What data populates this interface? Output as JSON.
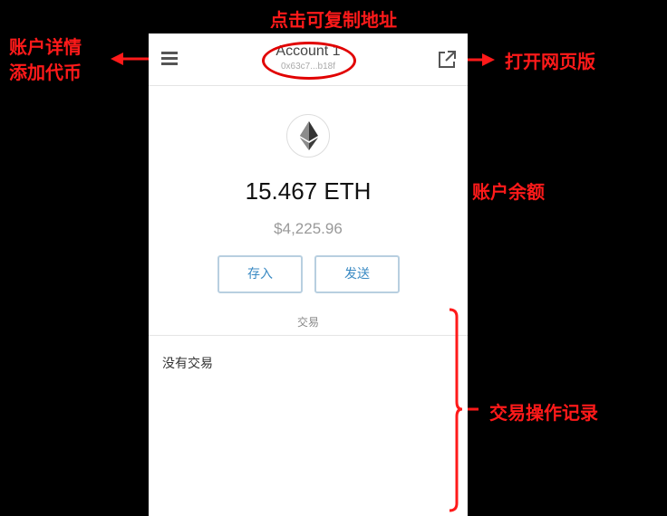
{
  "annotations": {
    "top": "点击可复制地址",
    "left_line1": "账户详情",
    "left_line2": "添加代币",
    "right_open": "打开网页版",
    "right_balance": "账户余额",
    "right_tx": "交易操作记录"
  },
  "header": {
    "menu_icon": "hamburger-menu-icon",
    "account_name": "Account 1",
    "account_address": "0x63c7...b18f",
    "external_icon": "open-external-icon"
  },
  "wallet": {
    "token_icon": "ethereum-icon",
    "balance": "15.467 ETH",
    "fiat_value": "$4,225.96",
    "deposit_label": "存入",
    "send_label": "发送"
  },
  "transactions": {
    "tab_label": "交易",
    "empty_text": "没有交易"
  },
  "colors": {
    "annotation": "#ff1a1a",
    "button_text": "#3a8ac3",
    "button_border": "#b8cfe0"
  }
}
